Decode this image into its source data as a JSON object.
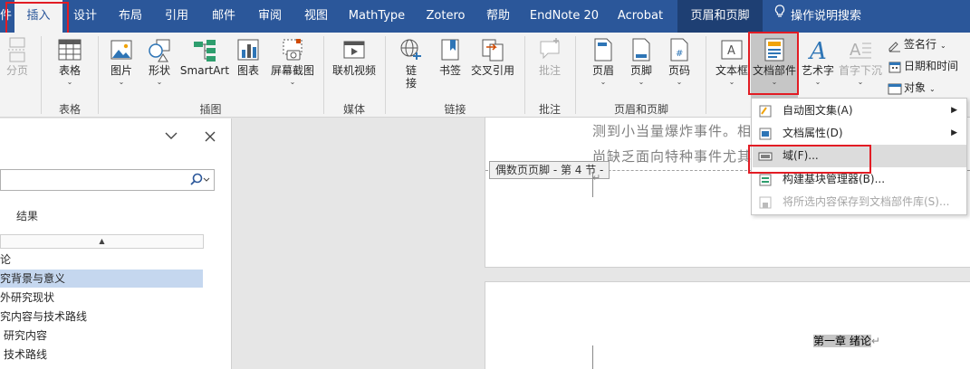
{
  "tabs": [
    {
      "label": "件"
    },
    {
      "label": "插入",
      "active": true
    },
    {
      "label": "设计"
    },
    {
      "label": "布局"
    },
    {
      "label": "引用"
    },
    {
      "label": "邮件"
    },
    {
      "label": "审阅"
    },
    {
      "label": "视图"
    },
    {
      "label": "MathType"
    },
    {
      "label": "Zotero"
    },
    {
      "label": "帮助"
    },
    {
      "label": "EndNote 20"
    },
    {
      "label": "Acrobat"
    },
    {
      "label": "页眉和页脚"
    },
    {
      "label": "操作说明搜索"
    }
  ],
  "ribbon": {
    "pagebreak": "分页",
    "table": "表格",
    "picture": "图片",
    "shapes": "形状",
    "smartart": "SmartArt",
    "chart": "图表",
    "screenshot": "屏幕截图",
    "online_video": "联机视频",
    "link": "链接",
    "bookmark": "书签",
    "crossref": "交叉引用",
    "comment": "批注",
    "header": "页眉",
    "footer": "页脚",
    "page_number": "页码",
    "textbox": "文本框",
    "quick_parts": "文档部件",
    "wordart": "艺术字",
    "dropcap": "首字下沉",
    "signature_line": "签名行",
    "datetime": "日期和时间",
    "object": "对象",
    "groups": {
      "tables": "表格",
      "illustrations": "插图",
      "media": "媒体",
      "links": "链接",
      "comments": "批注",
      "header_footer": "页眉和页脚"
    }
  },
  "nav": {
    "results_tab": "结果",
    "items": [
      "论",
      "究背景与意义",
      "外研究现状",
      "究内容与技术路线",
      "研究内容",
      "技术路线"
    ]
  },
  "doc": {
    "line1": "测到小当量爆炸事件。相",
    "line2": "尚缺乏面向特种事件尤其",
    "footer_tag": "偶数页页脚 - 第 4 节 -",
    "chapter_title": "第一章  绪论",
    "return_mark": "↵"
  },
  "menu": {
    "items": [
      {
        "label": "自动图文集(A)",
        "arrow": "▶"
      },
      {
        "label": "文档属性(D)",
        "arrow": "▶"
      },
      {
        "label": "域(F)..."
      },
      {
        "label": "构建基块管理器(B)..."
      },
      {
        "label": "将所选内容保存到文档部件库(S)..."
      }
    ]
  },
  "colors": {
    "tabbar": "#2b579a",
    "highlight_box": "#e21c24",
    "ribbon": "#f3f3f3",
    "nav_selected": "#c5d7ef"
  }
}
